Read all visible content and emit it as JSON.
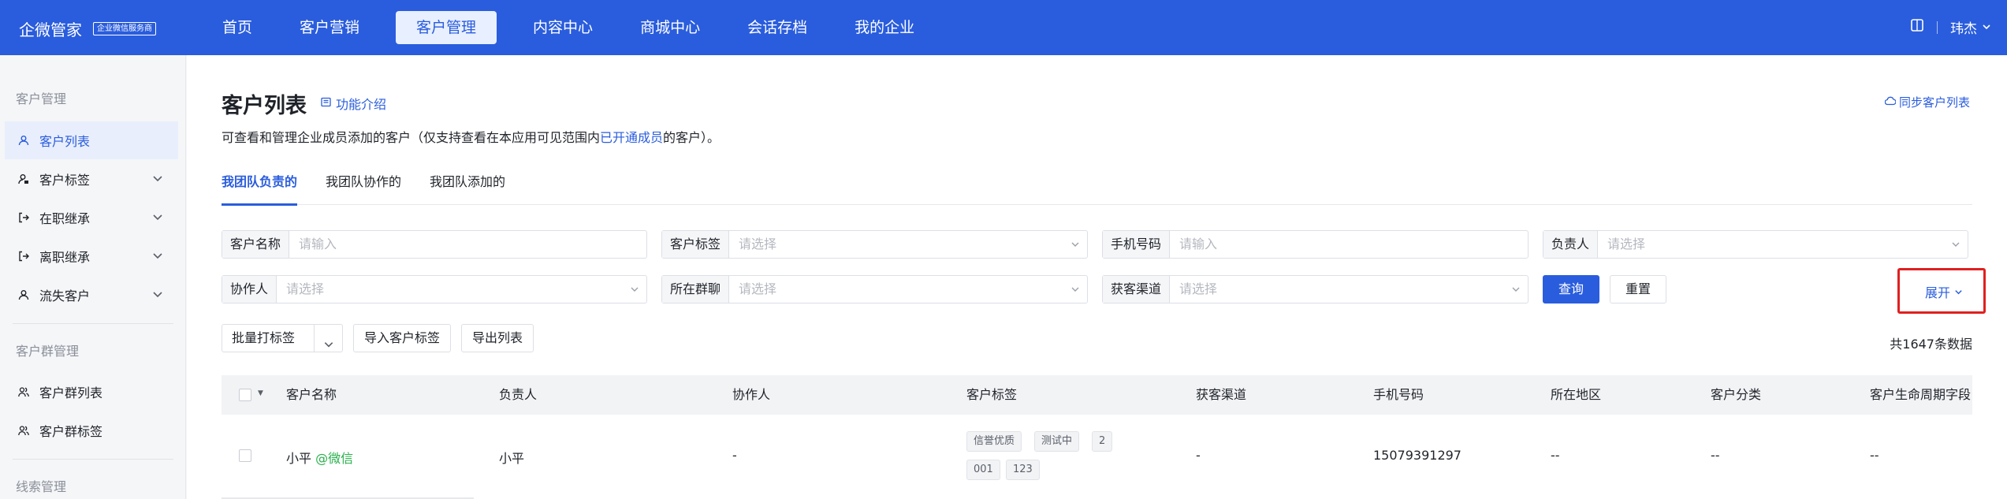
{
  "topbar": {
    "brand": "企微管家",
    "badge": "企业微信服务商",
    "nav": [
      "首页",
      "客户营销",
      "客户管理",
      "内容中心",
      "商城中心",
      "会话存档",
      "我的企业"
    ],
    "active_nav": "客户管理",
    "user": "玮杰",
    "icons": [
      "book-icon",
      "chevron-down-icon"
    ]
  },
  "sidebar": {
    "group1": "客户管理",
    "items1": [
      {
        "label": "客户列表",
        "icon": "user-icon",
        "active": true
      },
      {
        "label": "客户标签",
        "icon": "user-tag-icon",
        "expandable": true
      },
      {
        "label": "在职继承",
        "icon": "transfer-in-icon",
        "expandable": true
      },
      {
        "label": "离职继承",
        "icon": "transfer-out-icon",
        "expandable": true
      },
      {
        "label": "流失客户",
        "icon": "user-lost-icon",
        "expandable": true
      }
    ],
    "group2": "客户群管理",
    "items2": [
      {
        "label": "客户群列表",
        "icon": "group-icon"
      },
      {
        "label": "客户群标签",
        "icon": "group-tag-icon"
      }
    ],
    "group3": "线索管理"
  },
  "page": {
    "title": "客户列表",
    "intro_link": "功能介绍",
    "sync_link": "同步客户列表",
    "desc_before": "可查看和管理企业成员添加的客户（仅支持查看在本应用可见范围内",
    "desc_link": "已开通成员",
    "desc_after": "的客户）。",
    "tabs": [
      "我团队负责的",
      "我团队协作的",
      "我团队添加的"
    ],
    "active_tab": 0
  },
  "filters": {
    "customer_name": {
      "label": "客户名称",
      "placeholder": "请输入"
    },
    "customer_tag": {
      "label": "客户标签",
      "placeholder": "请选择"
    },
    "phone": {
      "label": "手机号码",
      "placeholder": "请输入"
    },
    "owner": {
      "label": "负责人",
      "placeholder": "请选择"
    },
    "collaborator": {
      "label": "协作人",
      "placeholder": "请选择"
    },
    "group_chat": {
      "label": "所在群聊",
      "placeholder": "请选择"
    },
    "channel": {
      "label": "获客渠道",
      "placeholder": "请选择"
    },
    "query_btn": "查询",
    "reset_btn": "重置",
    "expand": "展开"
  },
  "toolbar": {
    "batch_tag": "批量打标签",
    "import_tag": "导入客户标签",
    "export": "导出列表",
    "total": "共1647条数据"
  },
  "table": {
    "columns": [
      "客户名称",
      "负责人",
      "协作人",
      "客户标签",
      "获客渠道",
      "手机号码",
      "所在地区",
      "客户分类",
      "客户生命周期字段"
    ],
    "rows": [
      {
        "name": "小平",
        "source_tag": "@微信",
        "owner": "小平",
        "collaborator": "-",
        "tags_line1": [
          "信誉优质",
          "测试中",
          "2"
        ],
        "tags_line2": [
          "001",
          "123"
        ],
        "channel": "-",
        "phone": "15079391297",
        "region": "--",
        "category": "--",
        "lifecycle": "--"
      }
    ]
  },
  "colors": {
    "primary": "#2a5ddd",
    "highlight": "#e02020",
    "wechat": "#28b04b"
  }
}
